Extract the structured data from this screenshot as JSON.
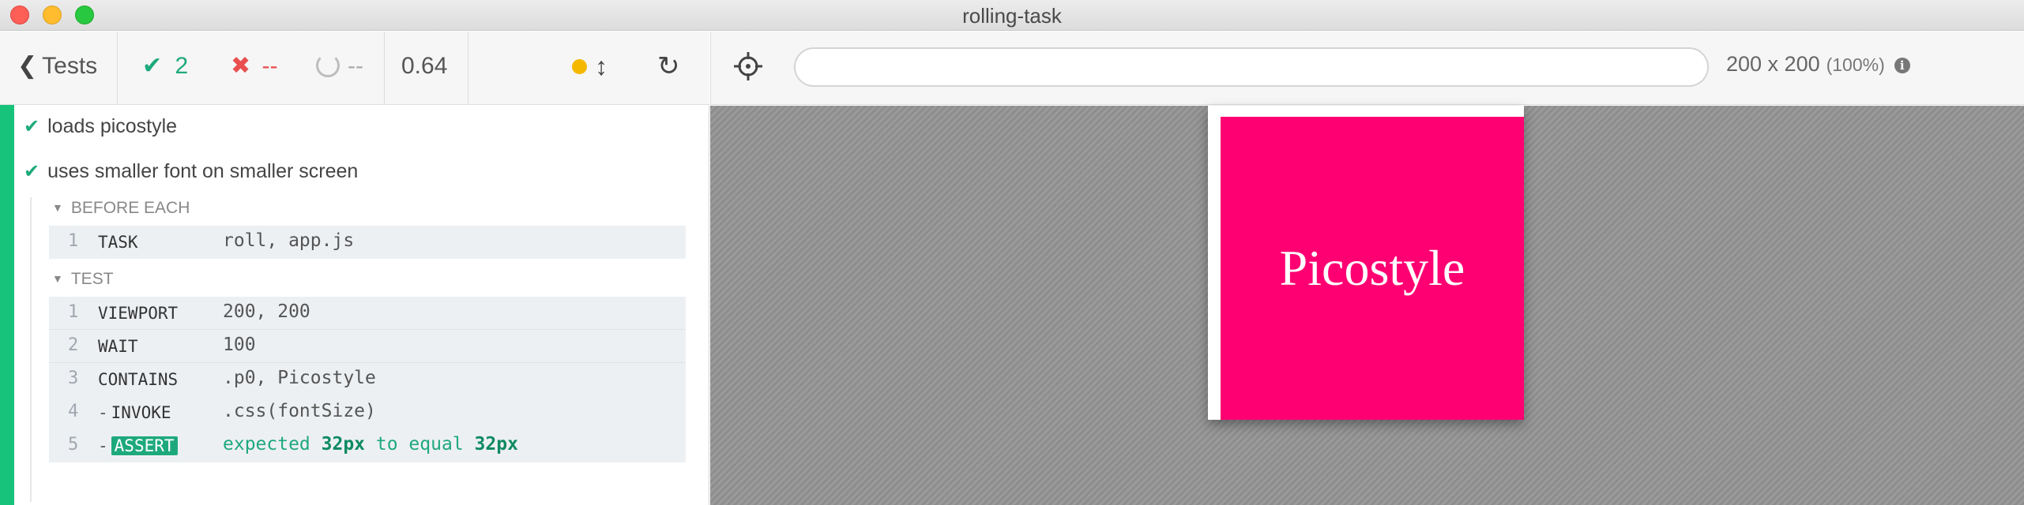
{
  "window": {
    "title": "rolling-task"
  },
  "reporter": {
    "tests_label": "Tests",
    "passed": "2",
    "failed": "--",
    "pending": "--",
    "duration": "0.64",
    "tests": [
      {
        "title": "loads picostyle"
      },
      {
        "title": "uses smaller font on smaller screen"
      }
    ],
    "hooks": {
      "before_each": {
        "title": "BEFORE EACH",
        "commands": [
          {
            "num": "1",
            "name": "TASK",
            "message": "roll, app.js"
          }
        ]
      },
      "test": {
        "title": "TEST",
        "commands": [
          {
            "num": "1",
            "name": "VIEWPORT",
            "message": "200, 200"
          },
          {
            "num": "2",
            "name": "WAIT",
            "message": "100"
          },
          {
            "num": "3",
            "name": "CONTAINS",
            "message": ".p0, Picostyle"
          },
          {
            "num": "4",
            "name": "INVOKE",
            "prefix": "-",
            "message": ".css(fontSize)"
          },
          {
            "num": "5",
            "name": "ASSERT",
            "prefix": "-",
            "message_parts": {
              "expected": "expected",
              "value1": "32px",
              "to_equal": "to equal",
              "value2": "32px"
            }
          }
        ]
      }
    }
  },
  "aut": {
    "url_value": "",
    "viewport": "200 x 200",
    "scale": "(100%)",
    "app_text": "Picostyle"
  },
  "colors": {
    "pass": "#1ea97c",
    "fail": "#e94f4f",
    "accent_bar": "#17c37b",
    "app_bg": "#ff0073"
  }
}
